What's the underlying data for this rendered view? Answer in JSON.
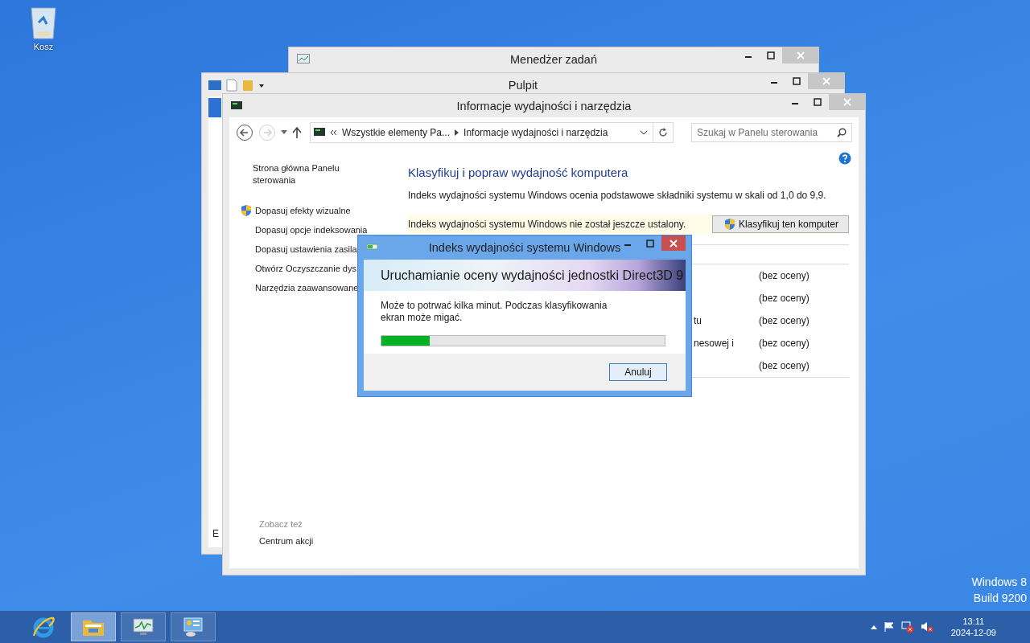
{
  "desktop": {
    "icons": [
      {
        "label": "Kosz"
      }
    ],
    "edition": [
      "Windows 8",
      "Build 9200"
    ]
  },
  "task_manager_window": {
    "title": "Menedżer zadań"
  },
  "desktop_window": {
    "title": "Pulpit",
    "partial_text": "E"
  },
  "control_panel_window": {
    "title": "Informacje wydajności i narzędzia",
    "nav": {
      "back": {
        "disabled": false
      },
      "forward": {
        "disabled": true
      }
    },
    "address": {
      "crumbs": [
        "Wszystkie elementy Pa...",
        "Informacje wydajności i narzędzia"
      ]
    },
    "search": {
      "placeholder": "Szukaj w Panelu sterowania"
    },
    "sidebar": {
      "home_link": "Strona główna Panelu sterowania",
      "items": [
        {
          "label": "Dopasuj efekty wizualne",
          "kind": "shield"
        },
        {
          "label": "Dopasuj opcje indeksowania",
          "kind": "plain"
        },
        {
          "label": "Dopasuj ustawienia zasila",
          "kind": "plain"
        },
        {
          "label": "Otwórz Oczyszczanie dys",
          "kind": "plain"
        },
        {
          "label": "Narzędzia zaawansowane",
          "kind": "plain"
        }
      ]
    },
    "see_also": {
      "heading": "Zobacz też",
      "links": [
        "Centrum akcji"
      ]
    },
    "heading": "Klasyfikuj i popraw wydajność komputera",
    "description": "Indeks wydajności systemu Windows ocenia podstawowe składniki systemu w skali od 1,0 do 9,9.",
    "status": {
      "text": "Indeks wydajności systemu Windows nie został jeszcze ustalony.",
      "button": "Klasyfikuj ten komputer"
    },
    "scores": [
      {
        "value": "(bez oceny)"
      },
      {
        "value": "(bez oceny)"
      },
      {
        "label": "tu",
        "value": "(bez oceny)"
      },
      {
        "label": "nesowej i",
        "value": "(bez oceny)"
      },
      {
        "value": "(bez oceny)"
      }
    ]
  },
  "dialog": {
    "title": "Indeks wydajności systemu Windows",
    "banner": "Uruchamianie oceny wydajności jednostki Direct3D 9",
    "message": "Może to potrwać kilka minut. Podczas klasyfikowania ekran może migać.",
    "progress": {
      "level": 0.17
    },
    "buttons": [
      "Anuluj"
    ]
  },
  "taskbar": {
    "buttons": [
      {
        "kind": "browser",
        "selected": false
      },
      {
        "kind": "folders",
        "selected": true
      },
      {
        "kind": "monitor",
        "selected": false
      },
      {
        "kind": "panel",
        "selected": false
      }
    ],
    "tray": {
      "time": "13:11",
      "date": "2024-12-09"
    }
  }
}
